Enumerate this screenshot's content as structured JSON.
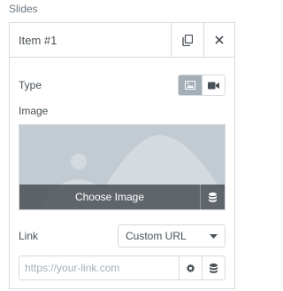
{
  "section": {
    "title": "Slides"
  },
  "item": {
    "title": "Item #1",
    "duplicate_icon": "copy-icon",
    "remove_icon": "close-icon"
  },
  "type": {
    "label": "Type",
    "options": [
      {
        "icon": "image-icon",
        "active": true
      },
      {
        "icon": "video-camera-icon",
        "active": false
      }
    ]
  },
  "image": {
    "label": "Image",
    "choose_label": "Choose Image",
    "library_icon": "database-icon"
  },
  "link": {
    "label": "Link",
    "selected": "Custom URL",
    "url_placeholder": "https://your-link.com",
    "url_value": "",
    "settings_icon": "gear-icon",
    "dynamic_icon": "database-icon"
  },
  "colors": {
    "border": "#d5dadf",
    "active_toggle": "#a4afb7",
    "media_bg": "#c2cbd2",
    "media_shape": "#d5dadf",
    "overlay": "#4a5056"
  }
}
